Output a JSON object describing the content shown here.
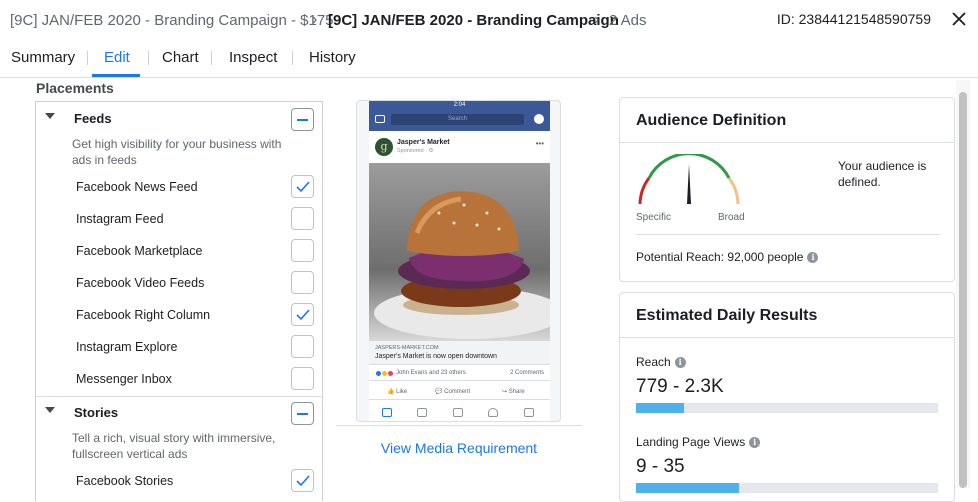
{
  "breadcrumb": {
    "campaign": "[9C] JAN/FEB 2020 - Branding Campaign - $175",
    "adset": "[9C] JAN/FEB 2020 - Branding Campaign",
    "ads": "2 Ads"
  },
  "id_label": "ID: 23844121548590759",
  "tabs": [
    {
      "label": "Summary"
    },
    {
      "label": "Edit"
    },
    {
      "label": "Chart"
    },
    {
      "label": "Inspect"
    },
    {
      "label": "History"
    }
  ],
  "placements": {
    "title": "Placements",
    "feeds": {
      "name": "Feeds",
      "description": "Get high visibility for your business with ads in feeds",
      "items": [
        {
          "label": "Facebook News Feed",
          "checked": true
        },
        {
          "label": "Instagram Feed",
          "checked": false
        },
        {
          "label": "Facebook Marketplace",
          "checked": false
        },
        {
          "label": "Facebook Video Feeds",
          "checked": false
        },
        {
          "label": "Facebook Right Column",
          "checked": true
        },
        {
          "label": "Instagram Explore",
          "checked": false
        },
        {
          "label": "Messenger Inbox",
          "checked": false
        }
      ]
    },
    "stories": {
      "name": "Stories",
      "description": "Tell a rich, visual story with immersive, fullscreen vertical ads",
      "items": [
        {
          "label": "Facebook Stories",
          "checked": true
        }
      ]
    }
  },
  "preview": {
    "status_time": "2:04",
    "search_placeholder": "Search",
    "avatar_letter": "g",
    "page_name": "Jasper's Market",
    "sponsored": "Sponsored · ⚙",
    "link_url": "JASPERS-MARKET.COM",
    "link_title": "Jasper's Market is now open downtown",
    "reactions_text": "John Evans and 23 others",
    "comments": "2 Comments",
    "like": "Like",
    "comment": "Comment",
    "share": "Share",
    "view_media": "View Media Requirement"
  },
  "audience": {
    "title": "Audience Definition",
    "specific": "Specific",
    "broad": "Broad",
    "status": "Your audience is defined.",
    "potential_reach": "Potential Reach: 92,000 people",
    "gauge_level": 0.5
  },
  "estimated": {
    "title": "Estimated Daily Results",
    "reach_label": "Reach",
    "reach_value": "779 - 2.3K",
    "reach_fill": 0.16,
    "lpv_label": "Landing Page Views",
    "lpv_value": "9 - 35",
    "lpv_fill": 0.34
  },
  "colors": {
    "accent": "#1877f2",
    "bar": "#4db1ec",
    "fb_blue": "#3b5998"
  }
}
